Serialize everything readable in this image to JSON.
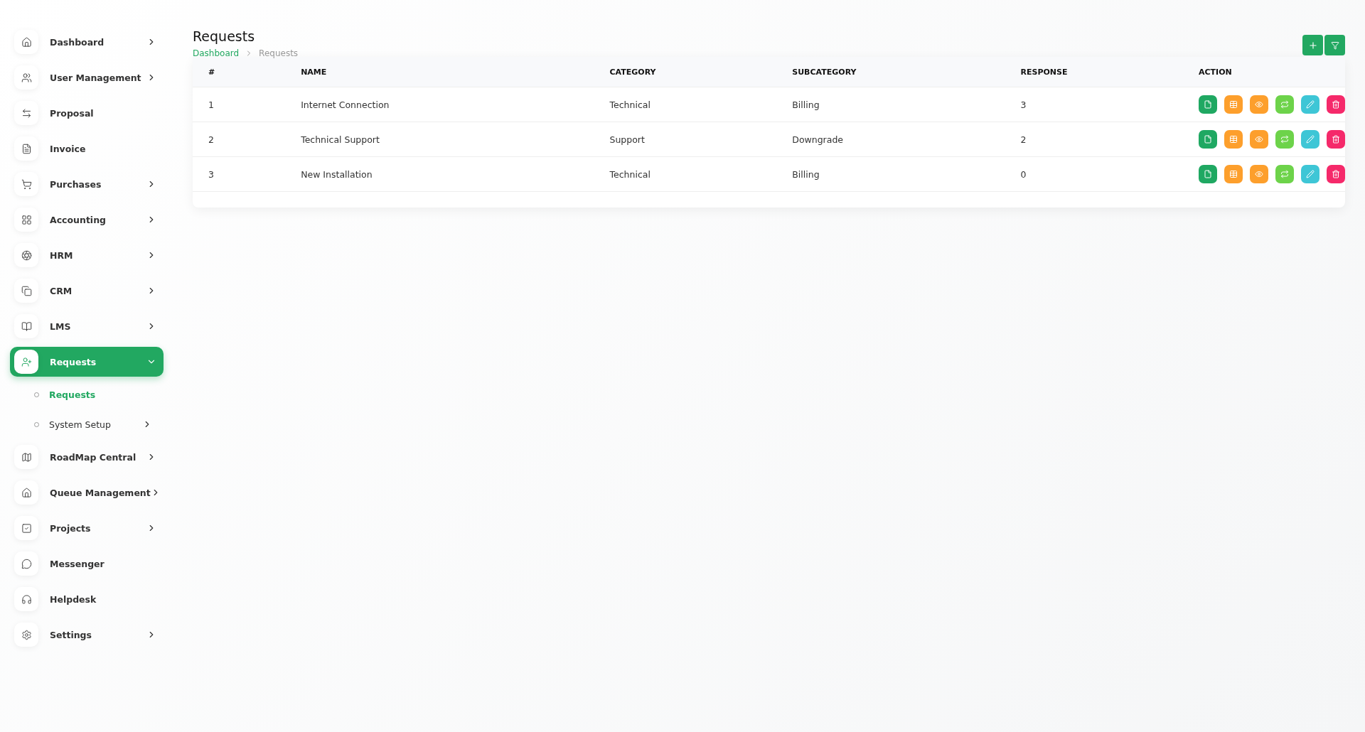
{
  "sidebar": {
    "items": [
      {
        "label": "Dashboard",
        "has_submenu": true,
        "expanded": false,
        "selected": false
      },
      {
        "label": "User Management",
        "has_submenu": true,
        "expanded": false,
        "selected": false
      },
      {
        "label": "Proposal",
        "has_submenu": false,
        "selected": false
      },
      {
        "label": "Invoice",
        "has_submenu": false,
        "selected": false
      },
      {
        "label": "Purchases",
        "has_submenu": true,
        "expanded": false,
        "selected": false
      },
      {
        "label": "Accounting",
        "has_submenu": true,
        "expanded": false,
        "selected": false
      },
      {
        "label": "HRM",
        "has_submenu": true,
        "expanded": false,
        "selected": false
      },
      {
        "label": "CRM",
        "has_submenu": true,
        "expanded": false,
        "selected": false
      },
      {
        "label": "LMS",
        "has_submenu": true,
        "expanded": false,
        "selected": false
      },
      {
        "label": "Requests",
        "has_submenu": true,
        "expanded": true,
        "selected": true,
        "children": [
          {
            "label": "Requests",
            "has_submenu": false,
            "selected": true
          },
          {
            "label": "System Setup",
            "has_submenu": true,
            "selected": false
          }
        ]
      },
      {
        "label": "RoadMap Central",
        "has_submenu": true,
        "expanded": false,
        "selected": false
      },
      {
        "label": "Queue Management",
        "has_submenu": true,
        "expanded": false,
        "selected": false
      },
      {
        "label": "Projects",
        "has_submenu": true,
        "expanded": false,
        "selected": false
      },
      {
        "label": "Messenger",
        "has_submenu": false,
        "selected": false
      },
      {
        "label": "Helpdesk",
        "has_submenu": false,
        "selected": false
      },
      {
        "label": "Settings",
        "has_submenu": true,
        "expanded": false,
        "selected": false
      }
    ]
  },
  "page": {
    "title": "Requests",
    "breadcrumbs": [
      "Dashboard",
      "Requests"
    ]
  },
  "table": {
    "columns": [
      "#",
      "NAME",
      "CATEGORY",
      "SUBCATEGORY",
      "RESPONSE",
      "ACTION"
    ],
    "row_actions": [
      {
        "kind": "document"
      },
      {
        "kind": "table"
      },
      {
        "kind": "view"
      },
      {
        "kind": "sync"
      },
      {
        "kind": "edit"
      },
      {
        "kind": "delete"
      }
    ],
    "rows": [
      [
        "1",
        "Internet Connection",
        "Technical",
        "Billing",
        "3"
      ],
      [
        "2",
        "Technical Support",
        "Support",
        "Downgrade",
        "2"
      ],
      [
        "3",
        "New Installation",
        "Technical",
        "Billing",
        "0"
      ]
    ]
  }
}
